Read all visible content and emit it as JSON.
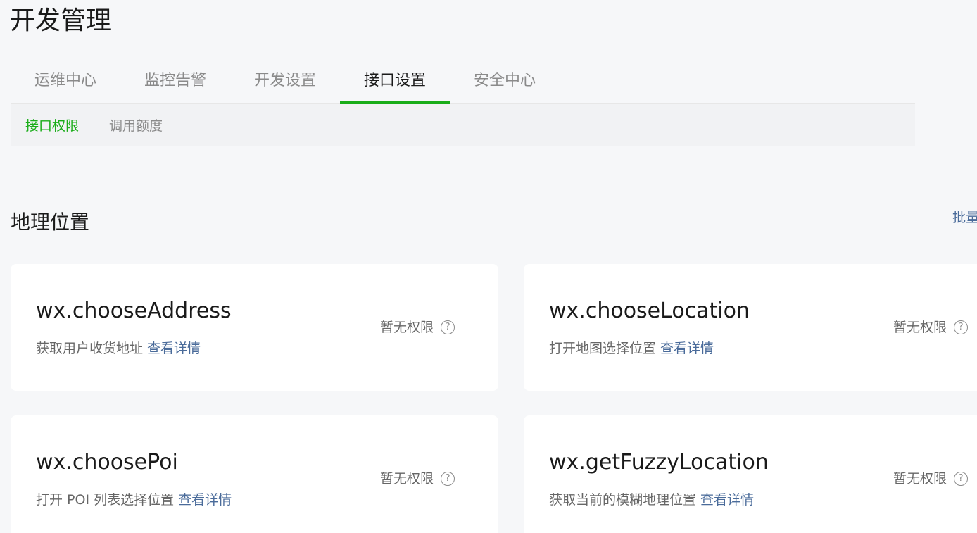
{
  "page": {
    "title": "开发管理"
  },
  "main_tabs": [
    {
      "label": "运维中心"
    },
    {
      "label": "监控告警"
    },
    {
      "label": "开发设置"
    },
    {
      "label": "接口设置"
    },
    {
      "label": "安全中心"
    }
  ],
  "sub_tabs": [
    {
      "label": "接口权限"
    },
    {
      "label": "调用额度"
    }
  ],
  "section": {
    "title": "地理位置",
    "batch_label": "批量"
  },
  "cards": [
    {
      "name": "wx.chooseAddress",
      "desc": "获取用户收货地址",
      "link": "查看详情",
      "status": "暂无权限"
    },
    {
      "name": "wx.chooseLocation",
      "desc": "打开地图选择位置",
      "link": "查看详情",
      "status": "暂无权限"
    },
    {
      "name": "wx.choosePoi",
      "desc": "打开 POI 列表选择位置",
      "link": "查看详情",
      "status": "暂无权限"
    },
    {
      "name": "wx.getFuzzyLocation",
      "desc": "获取当前的模糊地理位置",
      "link": "查看详情",
      "status": "暂无权限"
    }
  ],
  "icons": {
    "help": "question-circle-icon"
  },
  "colors": {
    "accent": "#1aad19",
    "link": "#4a6b9a"
  }
}
